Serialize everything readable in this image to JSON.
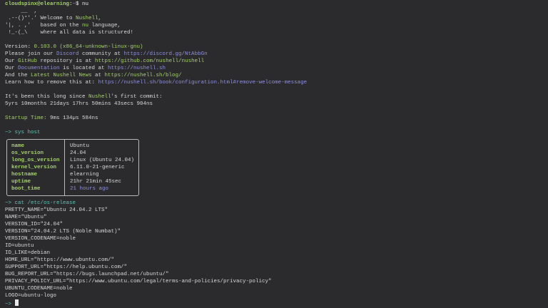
{
  "colors": {
    "background": "#2b2b2d",
    "green": "#a5d36b",
    "purple": "#8f90dc",
    "cyan": "#62c2b4"
  },
  "header_lines": [
    [
      {
        "t": "cloudspinx@elearning",
        "c": "greenb"
      },
      {
        "t": ":",
        "c": "white"
      },
      {
        "t": "~",
        "c": "purple"
      },
      {
        "t": "$ nu",
        "c": "white"
      }
    ],
    [
      {
        "t": "     __  ,",
        "c": "default"
      }
    ],
    [
      {
        "t": " .--()°'.' ",
        "c": "default"
      },
      {
        "t": "Welcome to ",
        "c": "default"
      },
      {
        "t": "Nushell",
        "c": "green"
      },
      {
        "t": ",",
        "c": "default"
      }
    ],
    [
      {
        "t": "'|, . ,'   ",
        "c": "default"
      },
      {
        "t": "based on the ",
        "c": "default"
      },
      {
        "t": "nu",
        "c": "green"
      },
      {
        "t": " language,",
        "c": "default"
      }
    ],
    [
      {
        "t": " !_-(_\\    ",
        "c": "default"
      },
      {
        "t": "where all data is structured!",
        "c": "default"
      }
    ],
    [
      {
        "t": "",
        "c": "default"
      }
    ],
    [
      {
        "t": "Version: ",
        "c": "default"
      },
      {
        "t": "0.103.0 (x86_64-unknown-linux-gnu)",
        "c": "green"
      }
    ],
    [
      {
        "t": "Please join our ",
        "c": "default"
      },
      {
        "t": "Discord",
        "c": "purple"
      },
      {
        "t": " community at ",
        "c": "default"
      },
      {
        "t": "https://discord.gg/NtAbbGn",
        "c": "purple"
      }
    ],
    [
      {
        "t": "Our ",
        "c": "default"
      },
      {
        "t": "GitHub",
        "c": "green"
      },
      {
        "t": " repository is at ",
        "c": "default"
      },
      {
        "t": "https://github.com/nushell/nushell",
        "c": "green"
      }
    ],
    [
      {
        "t": "Our ",
        "c": "default"
      },
      {
        "t": "Documentation",
        "c": "purple"
      },
      {
        "t": " is located at ",
        "c": "default"
      },
      {
        "t": "https://nushell.sh",
        "c": "purple"
      }
    ],
    [
      {
        "t": "And the ",
        "c": "default"
      },
      {
        "t": "Latest Nushell News",
        "c": "green"
      },
      {
        "t": " at ",
        "c": "default"
      },
      {
        "t": "https://nushell.sh/blog/",
        "c": "green"
      }
    ],
    [
      {
        "t": "Learn how to remove this at: ",
        "c": "default"
      },
      {
        "t": "https://nushell.sh/book/configuration.html#remove-welcome-message",
        "c": "purple"
      }
    ],
    [
      {
        "t": "",
        "c": "default"
      }
    ],
    [
      {
        "t": "It's been this long since ",
        "c": "default"
      },
      {
        "t": "Nushell",
        "c": "green"
      },
      {
        "t": "'s first commit:",
        "c": "default"
      }
    ],
    [
      {
        "t": "5yrs 10months 21days 17hrs 50mins 43secs 904ns",
        "c": "default"
      }
    ],
    [
      {
        "t": "",
        "c": "default"
      }
    ],
    [
      {
        "t": "Startup Time: ",
        "c": "green"
      },
      {
        "t": "9ms 134µs 584ns",
        "c": "default"
      }
    ],
    [
      {
        "t": "",
        "c": "default"
      }
    ],
    [
      {
        "t": "~> ",
        "c": "cyan"
      },
      {
        "t": "sys host",
        "c": "cyan"
      }
    ]
  ],
  "host_table": [
    {
      "key": "name",
      "value": "Ubuntu",
      "vc": "default"
    },
    {
      "key": "os_version",
      "value": "24.04",
      "vc": "default"
    },
    {
      "key": "long_os_version",
      "value": "Linux (Ubuntu 24.04)",
      "vc": "default"
    },
    {
      "key": "kernel_version",
      "value": "6.11.0-21-generic",
      "vc": "default"
    },
    {
      "key": "hostname",
      "value": "elearning",
      "vc": "default"
    },
    {
      "key": "uptime",
      "value": "21hr 21min 45sec",
      "vc": "default"
    },
    {
      "key": "boot_time",
      "value": "21 hours ago",
      "vc": "purple"
    }
  ],
  "footer_lines": [
    [
      {
        "t": "~> ",
        "c": "cyan"
      },
      {
        "t": "cat /etc/os-release",
        "c": "cyan"
      }
    ],
    [
      {
        "t": "PRETTY_NAME=\"Ubuntu 24.04.2 LTS\"",
        "c": "default"
      }
    ],
    [
      {
        "t": "NAME=\"Ubuntu\"",
        "c": "default"
      }
    ],
    [
      {
        "t": "VERSION_ID=\"24.04\"",
        "c": "default"
      }
    ],
    [
      {
        "t": "VERSION=\"24.04.2 LTS (Noble Numbat)\"",
        "c": "default"
      }
    ],
    [
      {
        "t": "VERSION_CODENAME=noble",
        "c": "default"
      }
    ],
    [
      {
        "t": "ID=ubuntu",
        "c": "default"
      }
    ],
    [
      {
        "t": "ID_LIKE=debian",
        "c": "default"
      }
    ],
    [
      {
        "t": "HOME_URL=\"https://www.ubuntu.com/\"",
        "c": "default"
      }
    ],
    [
      {
        "t": "SUPPORT_URL=\"https://help.ubuntu.com/\"",
        "c": "default"
      }
    ],
    [
      {
        "t": "BUG_REPORT_URL=\"https://bugs.launchpad.net/ubuntu/\"",
        "c": "default"
      }
    ],
    [
      {
        "t": "PRIVACY_POLICY_URL=\"https://www.ubuntu.com/legal/terms-and-policies/privacy-policy\"",
        "c": "default"
      }
    ],
    [
      {
        "t": "UBUNTU_CODENAME=noble",
        "c": "default"
      }
    ],
    [
      {
        "t": "LOGO=ubuntu-logo",
        "c": "default"
      }
    ]
  ],
  "prompt": {
    "symbol": "~> "
  }
}
